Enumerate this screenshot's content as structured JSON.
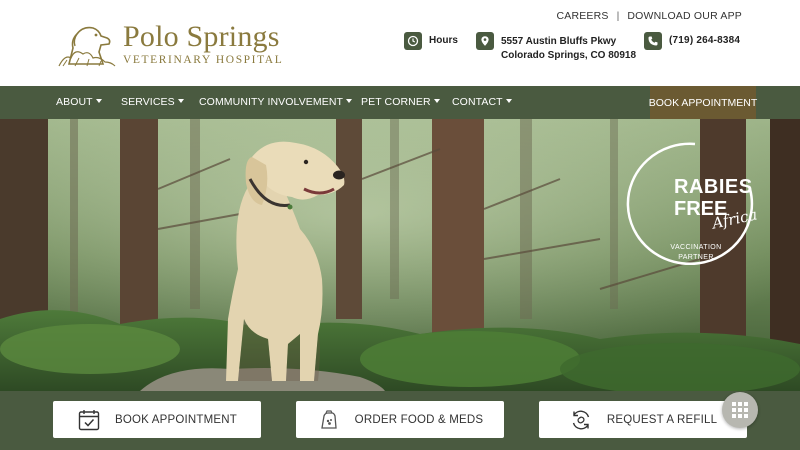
{
  "header": {
    "logo_title": "Polo Springs",
    "logo_subtitle": "VETERINARY HOSPITAL",
    "top_links": [
      "CAREERS",
      "DOWNLOAD OUR APP"
    ],
    "hours_label": "Hours",
    "address_line1": "5557 Austin Bluffs Pkwy",
    "address_line2": "Colorado Springs, CO 80918",
    "phone": "(719) 264-8384"
  },
  "nav": {
    "items": [
      "ABOUT",
      "SERVICES",
      "COMMUNITY INVOLVEMENT",
      "PET CORNER",
      "CONTACT"
    ],
    "book_label": "BOOK APPOINTMENT"
  },
  "hero": {
    "badge_line1": "RABIES",
    "badge_line2": "FREE",
    "badge_script": "Africa",
    "badge_caption1": "VACCINATION",
    "badge_caption2": "PARTNER"
  },
  "cta": {
    "book": "BOOK APPOINTMENT",
    "order": "ORDER FOOD & MEDS",
    "refill": "REQUEST A REFILL"
  },
  "colors": {
    "brand_green": "#4a5a40",
    "brand_gold": "#8a7a3e",
    "book_button": "#6b5a32"
  },
  "icons": [
    "dog-logo-icon",
    "clock-icon",
    "map-pin-icon",
    "phone-icon",
    "calendar-check-icon",
    "pet-food-icon",
    "refill-icon",
    "grid-menu-icon"
  ]
}
